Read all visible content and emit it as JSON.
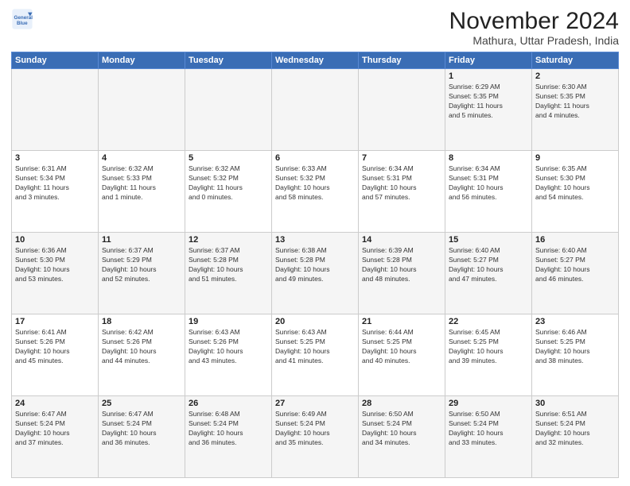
{
  "header": {
    "logo_line1": "General",
    "logo_line2": "Blue",
    "month_title": "November 2024",
    "location": "Mathura, Uttar Pradesh, India"
  },
  "weekdays": [
    "Sunday",
    "Monday",
    "Tuesday",
    "Wednesday",
    "Thursday",
    "Friday",
    "Saturday"
  ],
  "weeks": [
    [
      {
        "day": "",
        "info": ""
      },
      {
        "day": "",
        "info": ""
      },
      {
        "day": "",
        "info": ""
      },
      {
        "day": "",
        "info": ""
      },
      {
        "day": "",
        "info": ""
      },
      {
        "day": "1",
        "info": "Sunrise: 6:29 AM\nSunset: 5:35 PM\nDaylight: 11 hours\nand 5 minutes."
      },
      {
        "day": "2",
        "info": "Sunrise: 6:30 AM\nSunset: 5:35 PM\nDaylight: 11 hours\nand 4 minutes."
      }
    ],
    [
      {
        "day": "3",
        "info": "Sunrise: 6:31 AM\nSunset: 5:34 PM\nDaylight: 11 hours\nand 3 minutes."
      },
      {
        "day": "4",
        "info": "Sunrise: 6:32 AM\nSunset: 5:33 PM\nDaylight: 11 hours\nand 1 minute."
      },
      {
        "day": "5",
        "info": "Sunrise: 6:32 AM\nSunset: 5:32 PM\nDaylight: 11 hours\nand 0 minutes."
      },
      {
        "day": "6",
        "info": "Sunrise: 6:33 AM\nSunset: 5:32 PM\nDaylight: 10 hours\nand 58 minutes."
      },
      {
        "day": "7",
        "info": "Sunrise: 6:34 AM\nSunset: 5:31 PM\nDaylight: 10 hours\nand 57 minutes."
      },
      {
        "day": "8",
        "info": "Sunrise: 6:34 AM\nSunset: 5:31 PM\nDaylight: 10 hours\nand 56 minutes."
      },
      {
        "day": "9",
        "info": "Sunrise: 6:35 AM\nSunset: 5:30 PM\nDaylight: 10 hours\nand 54 minutes."
      }
    ],
    [
      {
        "day": "10",
        "info": "Sunrise: 6:36 AM\nSunset: 5:30 PM\nDaylight: 10 hours\nand 53 minutes."
      },
      {
        "day": "11",
        "info": "Sunrise: 6:37 AM\nSunset: 5:29 PM\nDaylight: 10 hours\nand 52 minutes."
      },
      {
        "day": "12",
        "info": "Sunrise: 6:37 AM\nSunset: 5:28 PM\nDaylight: 10 hours\nand 51 minutes."
      },
      {
        "day": "13",
        "info": "Sunrise: 6:38 AM\nSunset: 5:28 PM\nDaylight: 10 hours\nand 49 minutes."
      },
      {
        "day": "14",
        "info": "Sunrise: 6:39 AM\nSunset: 5:28 PM\nDaylight: 10 hours\nand 48 minutes."
      },
      {
        "day": "15",
        "info": "Sunrise: 6:40 AM\nSunset: 5:27 PM\nDaylight: 10 hours\nand 47 minutes."
      },
      {
        "day": "16",
        "info": "Sunrise: 6:40 AM\nSunset: 5:27 PM\nDaylight: 10 hours\nand 46 minutes."
      }
    ],
    [
      {
        "day": "17",
        "info": "Sunrise: 6:41 AM\nSunset: 5:26 PM\nDaylight: 10 hours\nand 45 minutes."
      },
      {
        "day": "18",
        "info": "Sunrise: 6:42 AM\nSunset: 5:26 PM\nDaylight: 10 hours\nand 44 minutes."
      },
      {
        "day": "19",
        "info": "Sunrise: 6:43 AM\nSunset: 5:26 PM\nDaylight: 10 hours\nand 43 minutes."
      },
      {
        "day": "20",
        "info": "Sunrise: 6:43 AM\nSunset: 5:25 PM\nDaylight: 10 hours\nand 41 minutes."
      },
      {
        "day": "21",
        "info": "Sunrise: 6:44 AM\nSunset: 5:25 PM\nDaylight: 10 hours\nand 40 minutes."
      },
      {
        "day": "22",
        "info": "Sunrise: 6:45 AM\nSunset: 5:25 PM\nDaylight: 10 hours\nand 39 minutes."
      },
      {
        "day": "23",
        "info": "Sunrise: 6:46 AM\nSunset: 5:25 PM\nDaylight: 10 hours\nand 38 minutes."
      }
    ],
    [
      {
        "day": "24",
        "info": "Sunrise: 6:47 AM\nSunset: 5:24 PM\nDaylight: 10 hours\nand 37 minutes."
      },
      {
        "day": "25",
        "info": "Sunrise: 6:47 AM\nSunset: 5:24 PM\nDaylight: 10 hours\nand 36 minutes."
      },
      {
        "day": "26",
        "info": "Sunrise: 6:48 AM\nSunset: 5:24 PM\nDaylight: 10 hours\nand 36 minutes."
      },
      {
        "day": "27",
        "info": "Sunrise: 6:49 AM\nSunset: 5:24 PM\nDaylight: 10 hours\nand 35 minutes."
      },
      {
        "day": "28",
        "info": "Sunrise: 6:50 AM\nSunset: 5:24 PM\nDaylight: 10 hours\nand 34 minutes."
      },
      {
        "day": "29",
        "info": "Sunrise: 6:50 AM\nSunset: 5:24 PM\nDaylight: 10 hours\nand 33 minutes."
      },
      {
        "day": "30",
        "info": "Sunrise: 6:51 AM\nSunset: 5:24 PM\nDaylight: 10 hours\nand 32 minutes."
      }
    ]
  ]
}
